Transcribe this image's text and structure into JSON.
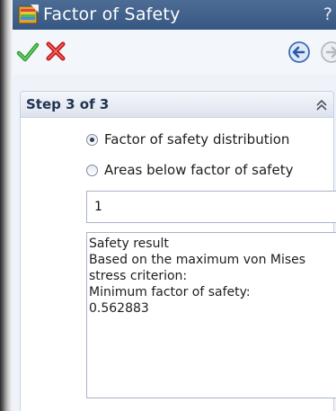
{
  "title_bar": {
    "title": "Factor of Safety",
    "help": "?"
  },
  "icons": {
    "app": "factor-of-safety-icon",
    "ok": "checkmark-icon",
    "cancel": "x-icon",
    "back": "arrow-left-icon",
    "forward": "arrow-right-icon",
    "collapse": "double-chevron-up-icon"
  },
  "colors": {
    "title_bar": "#3f5f8a",
    "ok_green": "#3aa33a",
    "cancel_red": "#cc1f1f",
    "section_bg": "#eef2f9"
  },
  "section": {
    "title": "Step 3 of 3",
    "options": [
      {
        "label": "Factor of safety distribution",
        "checked": true
      },
      {
        "label": "Areas below factor of safety",
        "checked": false
      }
    ],
    "value": "1",
    "result_lines": [
      "Safety result",
      "Based on the maximum von Mises",
      "stress criterion:",
      "Minimum factor of safety:",
      "0.562883"
    ]
  }
}
